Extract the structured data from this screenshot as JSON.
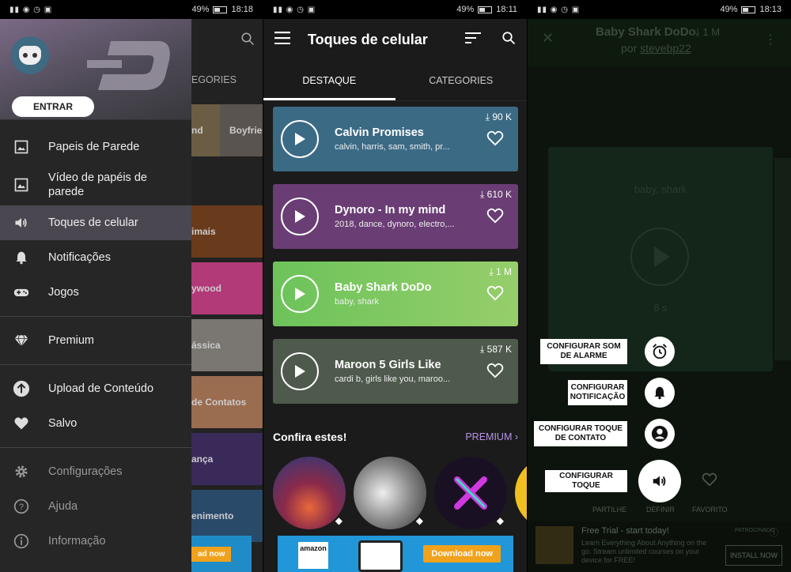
{
  "status_bars": [
    {
      "battery": "49%",
      "time": "18:18"
    },
    {
      "battery": "49%",
      "time": "18:11"
    },
    {
      "battery": "49%",
      "time": "18:13"
    }
  ],
  "drawer": {
    "enter_button": "ENTRAR",
    "items": [
      {
        "label": "Papeis de Parede",
        "icon": "image-icon"
      },
      {
        "label": "Vídeo de papéis de parede",
        "icon": "video-image-icon"
      },
      {
        "label": "Toques de celular",
        "icon": "speaker-icon",
        "active": true
      },
      {
        "label": "Notificações",
        "icon": "bell-icon"
      },
      {
        "label": "Jogos",
        "icon": "gamepad-icon"
      },
      {
        "label": "Premium",
        "icon": "diamond-icon"
      },
      {
        "label": "Upload de Conteúdo",
        "icon": "upload-icon"
      },
      {
        "label": "Salvo",
        "icon": "heart-icon"
      },
      {
        "label": "Configurações",
        "icon": "gear-icon"
      },
      {
        "label": "Ajuda",
        "icon": "help-icon"
      },
      {
        "label": "Informação",
        "icon": "info-icon"
      }
    ],
    "behind": {
      "tab": "EGORIES",
      "tiles": [
        "nd",
        "Boyfrie",
        "imais",
        "ywood",
        "ássica",
        "de Contatos",
        "ança",
        "enimento"
      ],
      "ad_button": "ad now"
    }
  },
  "ringtones": {
    "title": "Toques de celular",
    "tabs": [
      "DESTAQUE",
      "CATEGORIES"
    ],
    "cards": [
      {
        "name": "Calvin Promises",
        "tags": "calvin, harris, sam, smith, pr...",
        "downloads": "90 K",
        "color": "#3b6a85"
      },
      {
        "name": "Dynoro - In my mind",
        "tags": "2018, dance, dynoro, electro,...",
        "downloads": "610 K",
        "color": "#6a3d74"
      },
      {
        "name": "Baby Shark DoDo",
        "tags": "baby, shark",
        "downloads": "1 M",
        "color": "#7fc35f"
      },
      {
        "name": "Maroon 5  Girls Like",
        "tags": "cardi b, girls like you, maroo...",
        "downloads": "587 K",
        "color": "#4e5a4c"
      }
    ],
    "see_also": "Confira estes!",
    "premium_link": "PREMIUM",
    "ad": {
      "brand": "amazon",
      "button": "Download now"
    }
  },
  "detail": {
    "title": "Baby Shark DoDo",
    "size": "1 M",
    "by_prefix": "por",
    "author": "stevebp22",
    "keywords": "baby, shark",
    "duration": "8 s",
    "actions": [
      {
        "label": "CONFIGURAR SOM DE ALARME",
        "icon": "alarm-icon"
      },
      {
        "label": "CONFIGURAR NOTIFICAÇÃO",
        "icon": "bell-icon"
      },
      {
        "label": "CONFIGURAR TOQUE DE CONTATO",
        "icon": "contact-icon"
      },
      {
        "label": "CONFIGURAR TOQUE",
        "icon": "speaker-icon"
      }
    ],
    "bottom": [
      "PARTILHE",
      "DEFINIR",
      "FAVORITO"
    ],
    "ad": {
      "title": "Free Trial - start today!",
      "desc": "Learn Everything About Anything on the go. Stream unlimited courses on your device for FREE!",
      "button": "INSTALL NOW",
      "sponsored": "PATROCINADO"
    }
  }
}
